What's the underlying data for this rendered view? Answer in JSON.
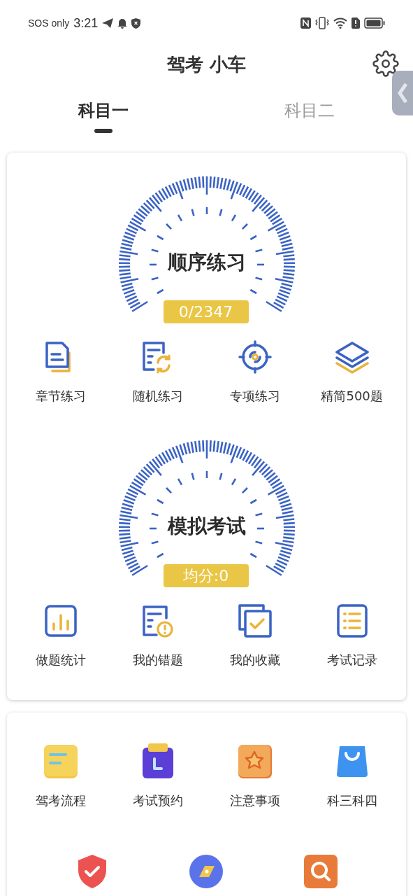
{
  "status_bar": {
    "carrier": "SOS only",
    "time": "3:21"
  },
  "header": {
    "title": "驾考 小车"
  },
  "tabs": [
    {
      "label": "科目一",
      "selected": true
    },
    {
      "label": "科目二",
      "selected": false
    }
  ],
  "practice": {
    "gauge": {
      "title": "顺序练习",
      "badge": "0/2347"
    },
    "items": [
      {
        "label": "章节练习"
      },
      {
        "label": "随机练习"
      },
      {
        "label": "专项练习"
      },
      {
        "label": "精简500题"
      }
    ]
  },
  "exam": {
    "gauge": {
      "title": "模拟考试",
      "badge": "均分:0"
    },
    "items": [
      {
        "label": "做题统计"
      },
      {
        "label": "我的错题"
      },
      {
        "label": "我的收藏"
      },
      {
        "label": "考试记录"
      }
    ]
  },
  "services": {
    "items": [
      {
        "label": "驾考流程"
      },
      {
        "label": "考试预约"
      },
      {
        "label": "注意事项"
      },
      {
        "label": "科三科四"
      }
    ]
  }
}
